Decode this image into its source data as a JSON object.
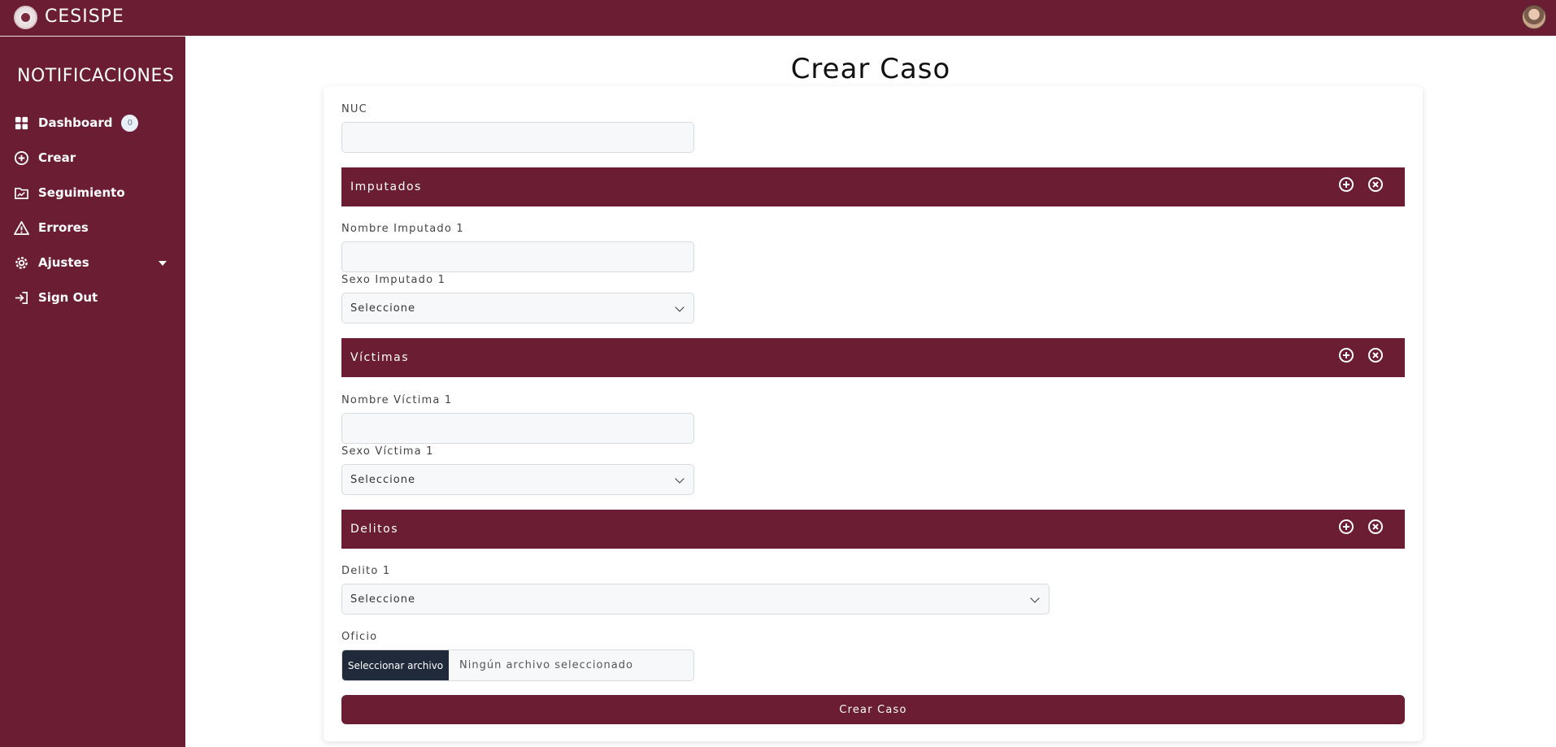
{
  "app": {
    "brand": "CESISPE"
  },
  "sidebar": {
    "title": "NOTIFICACIONES",
    "items": [
      {
        "label": "Dashboard",
        "icon": "dashboard-icon",
        "badge": "0"
      },
      {
        "label": "Crear",
        "icon": "plus-circle-icon"
      },
      {
        "label": "Seguimiento",
        "icon": "chart-folder-icon"
      },
      {
        "label": "Errores",
        "icon": "warning-icon"
      },
      {
        "label": "Ajustes",
        "icon": "gear-icon"
      },
      {
        "label": "Sign Out",
        "icon": "sign-out-icon"
      }
    ]
  },
  "main": {
    "title": "Crear Caso",
    "nuc_label": "NUC",
    "nuc_value": "",
    "imputados": {
      "title": "Imputados",
      "nombre_label": "Nombre Imputado 1",
      "nombre_value": "",
      "sexo_label": "Sexo Imputado 1",
      "sexo_selected": "Seleccione"
    },
    "victimas": {
      "title": "Víctimas",
      "nombre_label": "Nombre Víctima 1",
      "nombre_value": "",
      "sexo_label": "Sexo Víctima 1",
      "sexo_selected": "Seleccione"
    },
    "delitos": {
      "title": "Delitos",
      "delito_label": "Delito 1",
      "delito_selected": "Seleccione"
    },
    "oficio": {
      "label": "Oficio",
      "button": "Seleccionar archivo",
      "status": "Ningún archivo seleccionado"
    },
    "submit": "Crear Caso"
  },
  "colors": {
    "primary": "#6b1d34",
    "file_button": "#202a3a"
  }
}
